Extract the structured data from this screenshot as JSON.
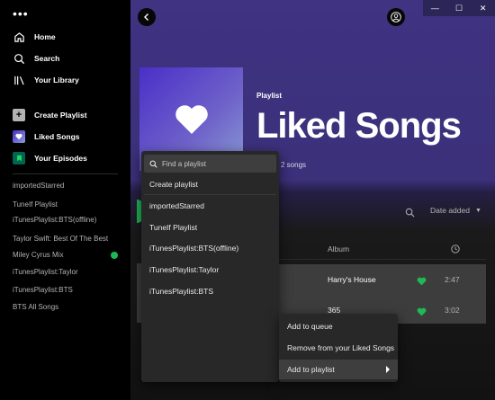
{
  "window": {
    "controls": [
      "—",
      "☐",
      "✕"
    ]
  },
  "sidebar": {
    "more": "•••",
    "nav": [
      {
        "label": "Home",
        "icon": "home-icon"
      },
      {
        "label": "Search",
        "icon": "search-icon"
      },
      {
        "label": "Your Library",
        "icon": "library-icon"
      }
    ],
    "actions": [
      {
        "label": "Create Playlist",
        "icon": "plus-icon"
      },
      {
        "label": "Liked Songs",
        "icon": "heart-icon"
      },
      {
        "label": "Your Episodes",
        "icon": "bookmark-icon"
      }
    ],
    "playlists": [
      "importedStarred",
      "TuneIf Playlist",
      "iTunesPlaylist:BTS(offline)",
      "Taylor Swift: Best Of The Best",
      "Miley Cyrus Mix",
      "iTunesPlaylist:Taylor",
      "iTunesPlaylist:BTS",
      "BTS All Songs"
    ]
  },
  "header": {
    "type_label": "Playlist",
    "title": "Liked Songs",
    "songs_count": "2 songs"
  },
  "toolbar": {
    "sort_label": "Date added"
  },
  "table": {
    "album_header": "Album",
    "rows": [
      {
        "album": "Harry's House",
        "duration": "2:47"
      },
      {
        "album": "365",
        "duration": "3:02"
      }
    ]
  },
  "dropdown": {
    "search_placeholder": "Find a playlist",
    "create": "Create playlist",
    "items": [
      "importedStarred",
      "TuneIf Playlist",
      "iTunesPlaylist:BTS(offline)",
      "iTunesPlaylist:Taylor",
      "iTunesPlaylist:BTS"
    ]
  },
  "context_menu": {
    "items": [
      "Add to queue",
      "Remove from your Liked Songs",
      "Add to playlist"
    ]
  },
  "colors": {
    "accent": "#1db954",
    "header_bg": "#3f3382"
  }
}
